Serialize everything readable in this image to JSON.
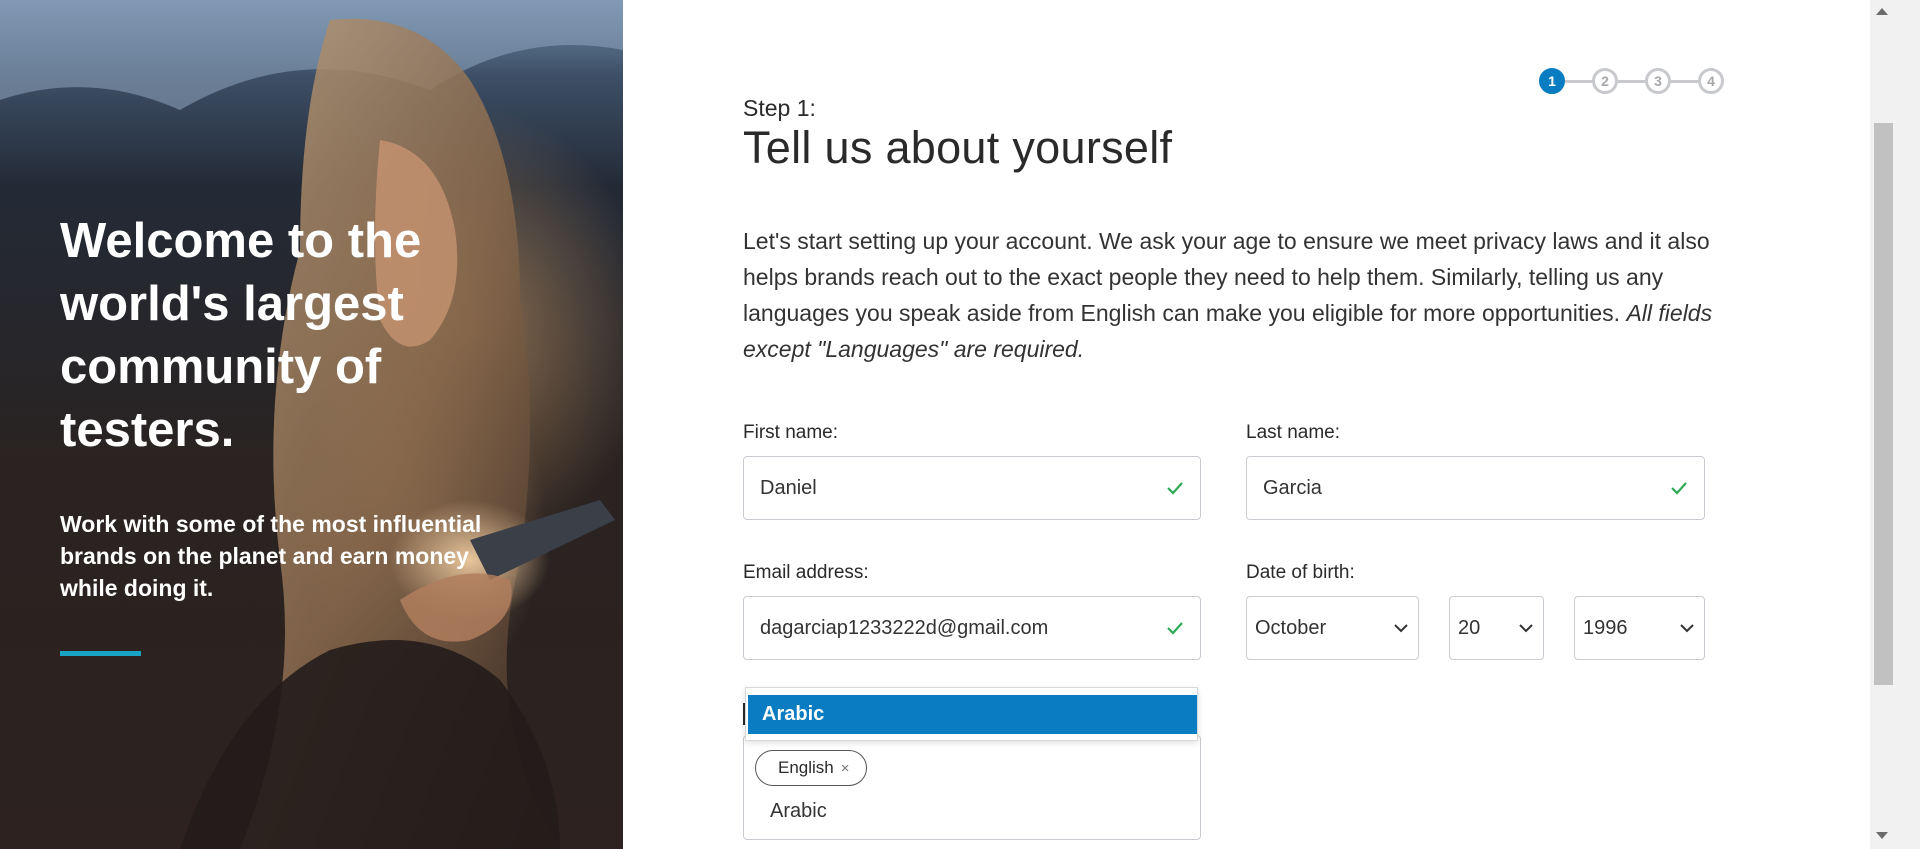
{
  "hero": {
    "title": "Welcome to the world's largest community of testers.",
    "subtitle": "Work with some of the most influential brands on the planet and earn money while doing it."
  },
  "stepper": {
    "steps": [
      "1",
      "2",
      "3",
      "4"
    ],
    "active_step": 1
  },
  "header": {
    "step_label": "Step 1:",
    "title": "Tell us about yourself"
  },
  "intro": {
    "text": "Let's start setting up your account. We ask your age to ensure we meet privacy laws and it also helps brands reach out to the exact people they need to help them. Similarly, telling us any languages you speak aside from English can make you eligible for more opportunities. ",
    "note": "All fields except \"Languages\" are required."
  },
  "form": {
    "first_name": {
      "label": "First name:",
      "value": "Daniel"
    },
    "last_name": {
      "label": "Last name:",
      "value": "Garcia"
    },
    "email": {
      "label": "Email address:",
      "value": "dagarciap1233222d@gmail.com"
    },
    "dob": {
      "label": "Date of birth:",
      "month": "October",
      "day": "20",
      "year": "1996"
    },
    "languages": {
      "selected_chips": [
        "English"
      ],
      "chip_remove_glyph": "×",
      "input_value": "Arabic",
      "dropdown_options": [
        "Arabic"
      ]
    }
  },
  "colors": {
    "accent_blue": "#0a7cc1",
    "hero_accent": "#1aa3c2",
    "valid_check": "#2eaa55"
  }
}
